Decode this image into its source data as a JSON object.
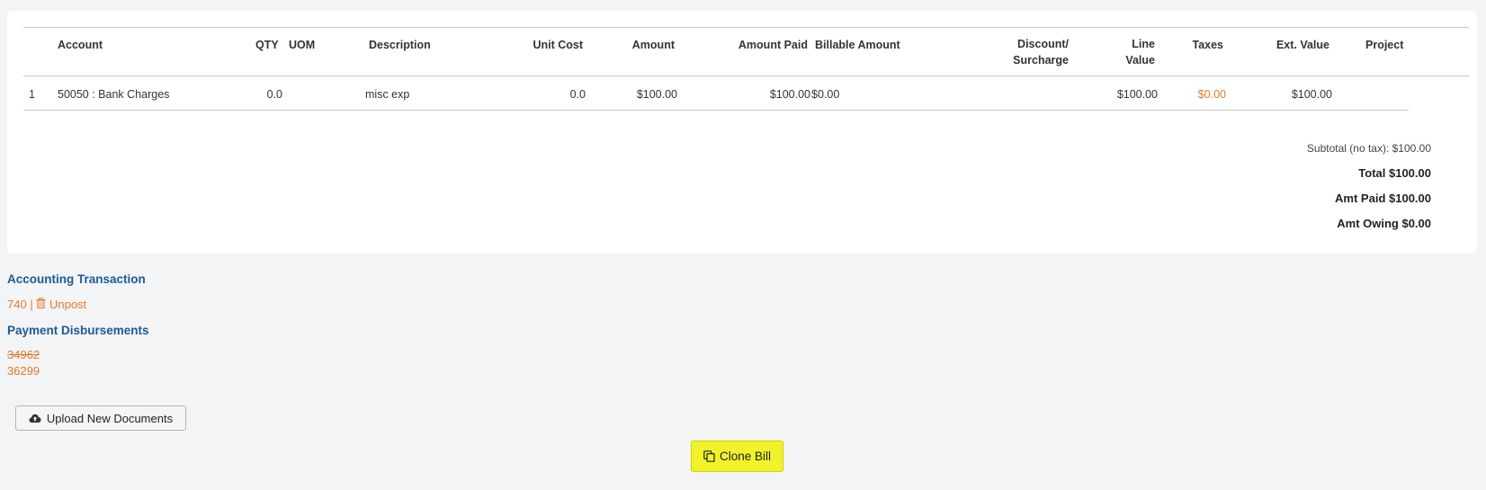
{
  "table": {
    "headers": {
      "account": "Account",
      "qty": "QTY",
      "uom": "UOM",
      "description": "Description",
      "unit_cost": "Unit Cost",
      "amount": "Amount",
      "amount_paid": "Amount Paid",
      "billable_amount": "Billable Amount",
      "discount_1": "Discount/",
      "discount_2": "Surcharge",
      "line_value_1": "Line",
      "line_value_2": "Value",
      "taxes": "Taxes",
      "ext_value": "Ext. Value",
      "project": "Project"
    },
    "rows": [
      {
        "num": "1",
        "account": "50050 : Bank Charges",
        "qty": "0.0",
        "uom": "",
        "description": "misc exp",
        "unit_cost": "0.0",
        "amount": "$100.00",
        "amount_paid": "$100.00",
        "billable_amount": "$0.00",
        "discount": "",
        "line_value": "$100.00",
        "taxes": "$0.00",
        "ext_value": "$100.00",
        "project": ""
      }
    ]
  },
  "totals": {
    "subtotal": "Subtotal (no tax): $100.00",
    "total": "Total $100.00",
    "amt_paid": "Amt Paid $100.00",
    "amt_owing": "Amt Owing $0.00"
  },
  "accounting": {
    "title": "Accounting Transaction",
    "txn_id": "740",
    "separator": "|",
    "unpost_label": "Unpost"
  },
  "payments": {
    "title": "Payment Disbursements",
    "items": [
      {
        "id": "34962",
        "voided": true
      },
      {
        "id": "36299",
        "voided": false
      }
    ]
  },
  "buttons": {
    "upload_label": "Upload New Documents",
    "clone_label": "Clone Bill"
  },
  "colors": {
    "link_orange": "#e07a2b",
    "heading_blue": "#1c5a94",
    "highlight_yellow": "#f2f22a"
  },
  "icons": {
    "unpost": "trash-icon",
    "upload": "cloud-upload-icon",
    "clone": "copy-icon"
  }
}
